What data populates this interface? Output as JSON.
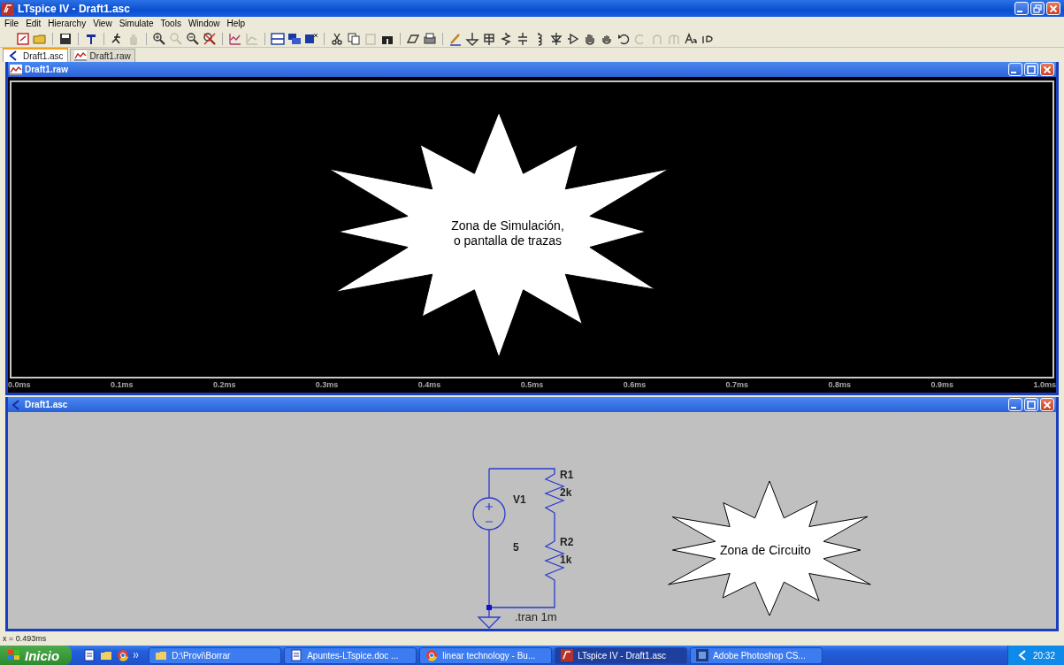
{
  "window": {
    "title": "LTspice IV - Draft1.asc"
  },
  "menu": [
    "File",
    "Edit",
    "Hierarchy",
    "View",
    "Simulate",
    "Tools",
    "Window",
    "Help"
  ],
  "doc_tabs": [
    {
      "label": "Draft1.asc",
      "kind": "schematic",
      "selected": true
    },
    {
      "label": "Draft1.raw",
      "kind": "waveform",
      "selected": false
    }
  ],
  "waveform_window": {
    "title": "Draft1.raw",
    "x_ticks": [
      "0.0ms",
      "0.1ms",
      "0.2ms",
      "0.3ms",
      "0.4ms",
      "0.5ms",
      "0.6ms",
      "0.7ms",
      "0.8ms",
      "0.9ms",
      "1.0ms"
    ],
    "callout": "Zona de Simulación,\no pantalla de trazas"
  },
  "schematic_window": {
    "title": "Draft1.asc",
    "components": [
      {
        "kind": "voltage",
        "name": "V1",
        "value": "5"
      },
      {
        "kind": "resistor",
        "name": "R1",
        "value": "2k"
      },
      {
        "kind": "resistor",
        "name": "R2",
        "value": "1k"
      }
    ],
    "directive": ".tran 1m",
    "callout": "Zona de Circuito"
  },
  "status_bar": "x = 0.493ms",
  "taskbar": {
    "start": "Inicio",
    "tasks": [
      {
        "label": "D:\\Provi\\Borrar",
        "kind": "folder",
        "selected": false
      },
      {
        "label": "Apuntes-LTspice.doc ...",
        "kind": "document",
        "selected": false
      },
      {
        "label": "linear technology - Bu...",
        "kind": "browser",
        "selected": false
      },
      {
        "label": "LTspice IV - Draft1.asc",
        "kind": "ltspice",
        "selected": true
      },
      {
        "label": "Adobe Photoshop CS...",
        "kind": "photoshop",
        "selected": false
      }
    ],
    "clock": "20:32"
  }
}
